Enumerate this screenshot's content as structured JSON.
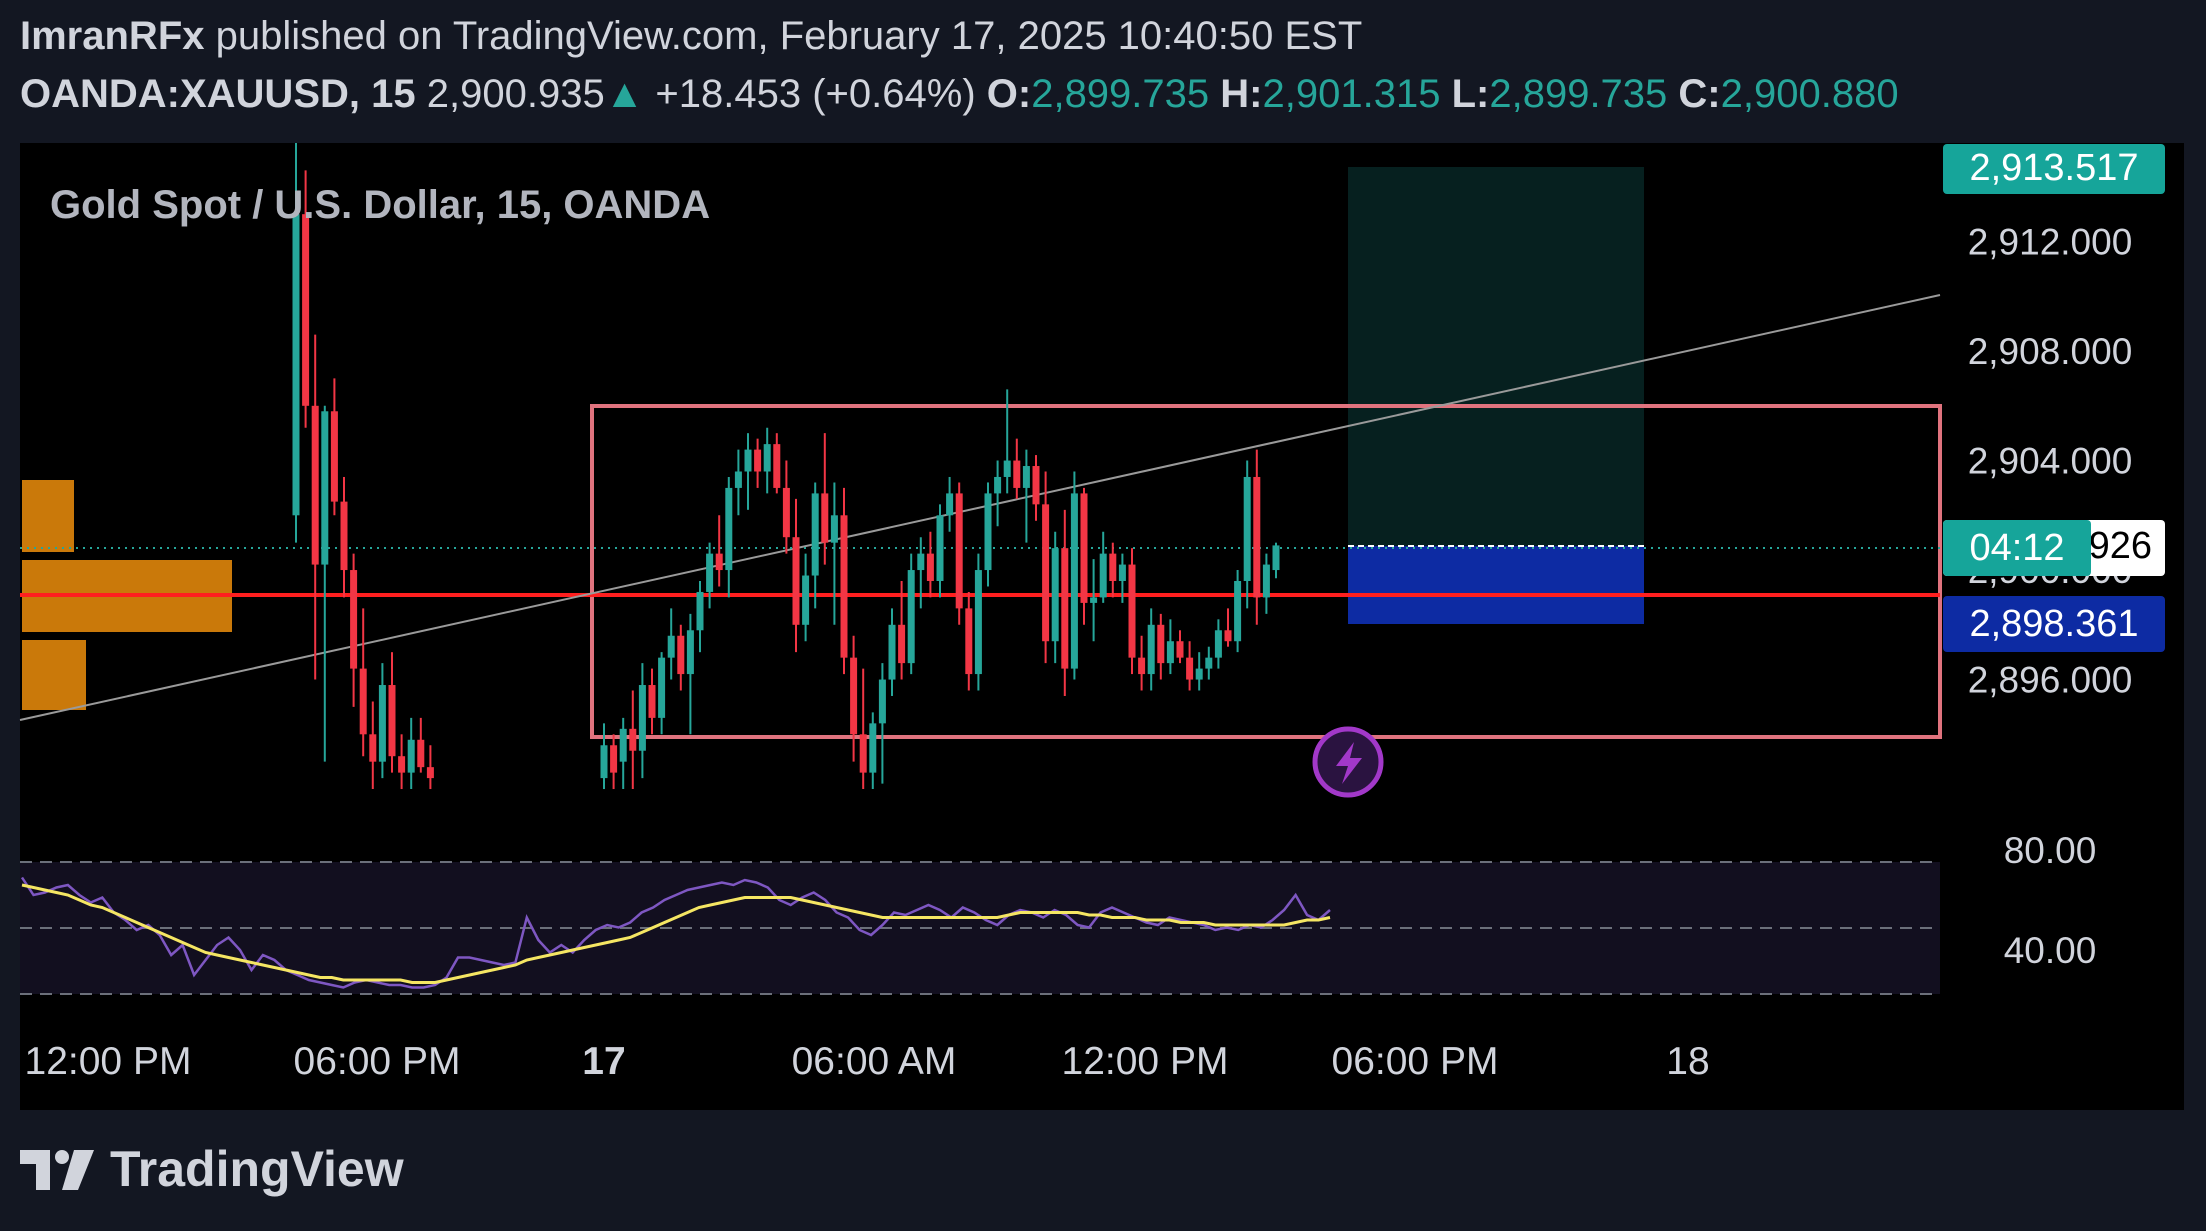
{
  "header": {
    "author": "ImranRFx",
    "published": "published on TradingView.com, February 17, 2025 10:40:50 EST",
    "symbol": "OANDA:XAUUSD, 15",
    "last": "2,900.935",
    "arrow": "▲",
    "change": "+18.453 (+0.64%)",
    "o_label": "O:",
    "o": "2,899.735",
    "h_label": "H:",
    "h": "2,901.315",
    "l_label": "L:",
    "l": "2,899.735",
    "c_label": "C:",
    "c": "2,900.880"
  },
  "chart": {
    "legend": "Gold Spot / U.S. Dollar, 15, OANDA",
    "price_badges": {
      "target": "2,913.517",
      "countdown": "04:12",
      "current_partial": "926",
      "entry": "2,898.361"
    },
    "colors": {
      "up": "#26a69a",
      "down": "#f23645",
      "rsi": "#7e57c2",
      "rsi_ma": "#f5e663",
      "level": "#ff1f1f",
      "box": "#e0737e",
      "stop_zone": "#0d2ba3",
      "target_zone": "#06201f"
    },
    "lightning_icon": "lightning-icon"
  },
  "chart_data": [
    {
      "type": "candlestick",
      "title": "Gold Spot / U.S. Dollar, 15, OANDA",
      "x_tick_labels": [
        "12:00 PM",
        "06:00 PM",
        "17",
        "06:00 AM",
        "12:00 PM",
        "06:00 PM",
        "18"
      ],
      "y_tick_labels": [
        "2,912.000",
        "2,908.000",
        "2,904.000",
        "2,900.000",
        "2,896.000"
      ],
      "y_ticks": [
        2912,
        2908,
        2904,
        2900,
        2896
      ],
      "ylim": [
        2891.6,
        2915.6
      ],
      "horizontal_levels": [
        {
          "name": "support",
          "value": 2898.2
        }
      ],
      "range_box": {
        "top": 2905.4,
        "bottom": 2894.4
      },
      "trendline": {
        "from": 2895.6,
        "to": 2909.1
      },
      "position": {
        "entry": 2898.361,
        "target": 2913.517,
        "stop": 2897.3
      },
      "candles": [
        [
          2902.0,
          2915.6,
          2901.0,
          2913.0
        ],
        [
          2913.0,
          2914.6,
          2905.2,
          2906.0
        ],
        [
          2906.0,
          2908.6,
          2896.0,
          2900.2
        ],
        [
          2900.2,
          2906.0,
          2893.0,
          2905.8
        ],
        [
          2905.8,
          2907.0,
          2902.0,
          2902.5
        ],
        [
          2902.5,
          2903.4,
          2899.0,
          2900.0
        ],
        [
          2900.0,
          2900.6,
          2895.0,
          2896.4
        ],
        [
          2896.4,
          2898.6,
          2893.2,
          2894.0
        ],
        [
          2894.0,
          2895.2,
          2892.0,
          2893.0
        ],
        [
          2893.0,
          2896.6,
          2892.4,
          2895.8
        ],
        [
          2895.8,
          2897.0,
          2892.6,
          2893.2
        ],
        [
          2893.2,
          2894.0,
          2892.0,
          2892.6
        ],
        [
          2892.6,
          2894.6,
          2892.0,
          2893.8
        ],
        [
          2893.8,
          2894.6,
          2892.6,
          2892.8
        ],
        [
          2892.8,
          2893.6,
          2892.0,
          2892.4
        ],
        [
          2892.4,
          2894.4,
          2892.0,
          2893.6
        ],
        [
          2893.6,
          2894.0,
          2892.0,
          2892.6
        ],
        [
          2893.0,
          2894.6,
          2892.0,
          2894.2
        ],
        [
          2894.2,
          2895.6,
          2892.0,
          2893.4
        ],
        [
          2893.4,
          2896.6,
          2892.4,
          2895.8
        ],
        [
          2895.8,
          2896.4,
          2894.0,
          2894.6
        ],
        [
          2894.6,
          2897.0,
          2894.0,
          2896.8
        ],
        [
          2896.8,
          2898.6,
          2896.0,
          2897.6
        ],
        [
          2897.6,
          2898.0,
          2895.6,
          2896.2
        ],
        [
          2896.2,
          2898.4,
          2894.0,
          2897.8
        ],
        [
          2897.8,
          2899.6,
          2897.0,
          2899.2
        ],
        [
          2899.2,
          2901.0,
          2898.6,
          2900.6
        ],
        [
          2900.6,
          2902.0,
          2899.4,
          2900.0
        ],
        [
          2900.0,
          2903.4,
          2899.0,
          2903.0
        ],
        [
          2903.0,
          2904.4,
          2902.0,
          2903.6
        ],
        [
          2903.6,
          2905.0,
          2902.2,
          2904.4
        ],
        [
          2904.4,
          2904.8,
          2903.0,
          2903.6
        ],
        [
          2903.6,
          2905.2,
          2902.8,
          2904.6
        ],
        [
          2904.6,
          2905.0,
          2902.8,
          2903.0
        ],
        [
          2903.0,
          2904.0,
          2900.6,
          2901.2
        ],
        [
          2901.2,
          2902.6,
          2897.0,
          2898.0
        ],
        [
          2898.0,
          2900.6,
          2897.4,
          2899.8
        ],
        [
          2899.8,
          2903.2,
          2898.6,
          2902.8
        ],
        [
          2902.8,
          2905.0,
          2900.2,
          2901.0
        ],
        [
          2901.0,
          2903.2,
          2898.0,
          2902.0
        ],
        [
          2902.0,
          2903.0,
          2896.2,
          2896.8
        ],
        [
          2896.8,
          2897.6,
          2893.0,
          2894.0
        ],
        [
          2894.0,
          2896.4,
          2892.0,
          2892.6
        ],
        [
          2892.6,
          2894.8,
          2892.0,
          2894.4
        ],
        [
          2894.4,
          2896.6,
          2892.2,
          2896.0
        ],
        [
          2896.0,
          2898.6,
          2895.4,
          2898.0
        ],
        [
          2898.0,
          2899.6,
          2896.0,
          2896.6
        ],
        [
          2896.6,
          2900.6,
          2896.2,
          2900.0
        ],
        [
          2900.0,
          2901.2,
          2898.6,
          2900.6
        ],
        [
          2900.6,
          2901.4,
          2899.0,
          2899.6
        ],
        [
          2899.6,
          2902.4,
          2899.0,
          2902.0
        ],
        [
          2902.0,
          2903.4,
          2901.4,
          2902.8
        ],
        [
          2902.8,
          2903.2,
          2898.0,
          2898.6
        ],
        [
          2898.6,
          2899.2,
          2895.6,
          2896.2
        ],
        [
          2896.2,
          2900.6,
          2895.6,
          2900.0
        ],
        [
          2900.0,
          2903.2,
          2899.4,
          2902.8
        ],
        [
          2902.8,
          2904.0,
          2901.6,
          2903.4
        ],
        [
          2903.4,
          2906.6,
          2902.8,
          2904.0
        ],
        [
          2904.0,
          2904.8,
          2902.6,
          2903.0
        ],
        [
          2903.0,
          2904.4,
          2901.0,
          2903.8
        ],
        [
          2903.8,
          2904.2,
          2901.8,
          2902.4
        ],
        [
          2902.4,
          2903.6,
          2896.6,
          2897.4
        ],
        [
          2897.4,
          2901.4,
          2896.6,
          2900.8
        ],
        [
          2900.8,
          2902.2,
          2895.4,
          2896.4
        ],
        [
          2896.4,
          2903.6,
          2896.0,
          2902.8
        ],
        [
          2902.8,
          2903.0,
          2898.0,
          2898.8
        ],
        [
          2898.8,
          2900.4,
          2897.4,
          2899.0
        ],
        [
          2899.0,
          2901.4,
          2898.8,
          2900.6
        ],
        [
          2900.6,
          2901.0,
          2899.0,
          2899.6
        ],
        [
          2899.6,
          2900.6,
          2898.8,
          2900.2
        ],
        [
          2900.2,
          2900.8,
          2896.2,
          2896.8
        ],
        [
          2896.8,
          2897.6,
          2895.6,
          2896.2
        ],
        [
          2896.2,
          2898.6,
          2895.6,
          2898.0
        ],
        [
          2898.0,
          2898.4,
          2896.0,
          2896.6
        ],
        [
          2896.6,
          2898.2,
          2896.2,
          2897.4
        ],
        [
          2897.4,
          2897.8,
          2896.6,
          2896.8
        ],
        [
          2896.8,
          2897.4,
          2895.6,
          2896.0
        ],
        [
          2896.0,
          2897.0,
          2895.6,
          2896.4
        ],
        [
          2896.4,
          2897.2,
          2896.0,
          2896.8
        ],
        [
          2896.8,
          2898.2,
          2896.4,
          2897.8
        ],
        [
          2897.8,
          2898.6,
          2897.2,
          2897.4
        ],
        [
          2897.4,
          2900.0,
          2897.0,
          2899.6
        ],
        [
          2899.6,
          2904.0,
          2898.6,
          2903.4
        ],
        [
          2903.4,
          2904.4,
          2898.0,
          2899.0
        ],
        [
          2899.0,
          2900.6,
          2898.4,
          2900.2
        ],
        [
          2900.0,
          2901.0,
          2899.7,
          2900.9
        ]
      ]
    },
    {
      "type": "line",
      "title": "RSI",
      "y_tick_labels": [
        "80.00",
        "40.00"
      ],
      "ylim": [
        16,
        96
      ],
      "bands": [
        70,
        50,
        30
      ],
      "series": [
        {
          "values": [
            69,
            62,
            63,
            65,
            66,
            62,
            59,
            61,
            55,
            52,
            48,
            50,
            46,
            38,
            42,
            30,
            36,
            42,
            45,
            40,
            32,
            38,
            36,
            32,
            30,
            28,
            27,
            26,
            25,
            27,
            28,
            27,
            26,
            26,
            25,
            25,
            26,
            29,
            37,
            37,
            36,
            35,
            34,
            35,
            53,
            44,
            39,
            42,
            39,
            44,
            48,
            50,
            49,
            51,
            55,
            57,
            60,
            62,
            64,
            65,
            66,
            67,
            66,
            68,
            67,
            65,
            60,
            58,
            61,
            63,
            60,
            55,
            53,
            48,
            46,
            50,
            55,
            54,
            56,
            58,
            56,
            53,
            57,
            55,
            52,
            50,
            54,
            56,
            55,
            53,
            56,
            54,
            50,
            49,
            55,
            57,
            55,
            53,
            51,
            50,
            53,
            52,
            51,
            50,
            48,
            49,
            48,
            50,
            49,
            52,
            56,
            62,
            54,
            52,
            56
          ]
        },
        {
          "values": [
            66,
            65,
            64,
            63,
            62,
            60,
            58,
            57,
            55,
            53,
            51,
            49,
            47,
            45,
            43,
            41,
            39,
            38,
            37,
            36,
            35,
            34,
            33,
            32,
            31,
            30,
            29,
            29,
            28,
            28,
            28,
            28,
            28,
            28,
            27,
            27,
            27,
            28,
            29,
            30,
            31,
            32,
            33,
            34,
            36,
            37,
            38,
            39,
            40,
            41,
            42,
            43,
            44,
            45,
            47,
            49,
            51,
            53,
            55,
            57,
            58,
            59,
            60,
            61,
            61,
            61,
            61,
            61,
            60,
            59,
            58,
            57,
            56,
            55,
            54,
            53,
            53,
            53,
            53,
            53,
            53,
            53,
            53,
            53,
            53,
            53,
            54,
            55,
            55,
            55,
            55,
            55,
            55,
            54,
            54,
            53,
            53,
            53,
            52,
            52,
            52,
            51,
            51,
            51,
            50,
            50,
            50,
            50,
            50,
            50,
            50,
            51,
            52,
            52,
            53
          ]
        }
      ]
    }
  ],
  "x_axis": {
    "labels": [
      "12:00 PM",
      "06:00 PM",
      "17",
      "06:00 AM",
      "12:00 PM",
      "06:00 PM",
      "18"
    ]
  },
  "footer": {
    "brand": "TradingView"
  }
}
